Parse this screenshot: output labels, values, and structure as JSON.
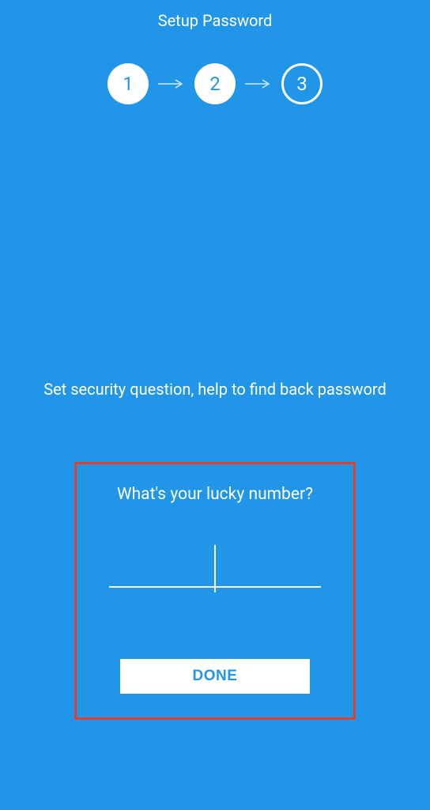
{
  "header": {
    "title": "Setup Password"
  },
  "stepper": {
    "steps": [
      "1",
      "2",
      "3"
    ],
    "current": 3
  },
  "instruction": "Set security question, help to find back password",
  "question": "What's your lucky number?",
  "answer_value": "",
  "done_label": "DONE"
}
